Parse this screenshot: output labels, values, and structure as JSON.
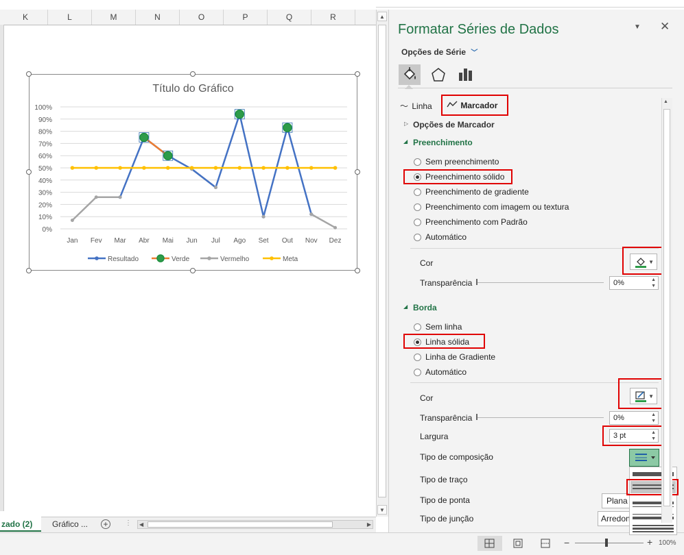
{
  "sheet": {
    "columns": [
      "K",
      "L",
      "M",
      "N",
      "O",
      "P",
      "Q",
      "R"
    ],
    "tabs": [
      {
        "label": "zado (2)",
        "active": true
      },
      {
        "label": "Gráfico   ...",
        "active": false
      }
    ]
  },
  "chart": {
    "title": "Título do Gráfico",
    "ytick_labels": [
      "100%",
      "90%",
      "80%",
      "70%",
      "60%",
      "50%",
      "40%",
      "30%",
      "20%",
      "10%",
      "0%"
    ],
    "legend": [
      "Resultado",
      "Verde",
      "Vermelho",
      "Meta"
    ]
  },
  "chart_data": {
    "type": "line",
    "title": "Título do Gráfico",
    "categories": [
      "Jan",
      "Fev",
      "Mar",
      "Abr",
      "Mai",
      "Jun",
      "Jul",
      "Ago",
      "Set",
      "Out",
      "Nov",
      "Dez"
    ],
    "ylim": [
      0,
      1
    ],
    "grid": true,
    "legend_position": "bottom",
    "series": [
      {
        "name": "Resultado",
        "color": "#4472c4",
        "values": [
          null,
          null,
          0.26,
          0.75,
          0.6,
          0.49,
          0.34,
          0.94,
          0.1,
          0.83,
          0.12,
          null
        ]
      },
      {
        "name": "Verde",
        "color": "#ed7d31",
        "marker_color": "#2e9c4a",
        "values": [
          null,
          null,
          null,
          0.75,
          0.6,
          null,
          null,
          0.94,
          null,
          0.83,
          null,
          null
        ]
      },
      {
        "name": "Vermelho",
        "color": "#a5a5a5",
        "values": [
          0.07,
          0.26,
          0.26,
          null,
          null,
          0.49,
          0.34,
          null,
          0.1,
          null,
          0.12,
          0.01
        ]
      },
      {
        "name": "Meta",
        "color": "#ffc000",
        "values": [
          0.5,
          0.5,
          0.5,
          0.5,
          0.5,
          0.5,
          0.5,
          0.5,
          0.5,
          0.5,
          0.5,
          0.5
        ]
      }
    ]
  },
  "pane": {
    "title": "Formatar Séries de Dados",
    "series_options": "Opções de Série",
    "tab_line": "Linha",
    "tab_marker": "Marcador",
    "marker_options": "Opções de Marcador",
    "fill_section": "Preenchimento",
    "fill_options": [
      "Sem preenchimento",
      "Preenchimento sólido",
      "Preenchimento de gradiente",
      "Preenchimento com imagem ou textura",
      "Preenchimento com Padrão",
      "Automático"
    ],
    "fill_selected": "Preenchimento sólido",
    "color_label": "Cor",
    "transparency_label": "Transparência",
    "fill_transparency": "0%",
    "border_section": "Borda",
    "border_options": [
      "Sem linha",
      "Linha sólida",
      "Linha de Gradiente",
      "Automático"
    ],
    "border_selected": "Linha sólida",
    "border_color_label": "Cor",
    "border_transparency_label": "Transparência",
    "border_transparency": "0%",
    "width_label": "Largura",
    "width_value": "3 pt",
    "compound_label": "Tipo de composição",
    "dash_label": "Tipo de traço",
    "cap_label": "Tipo de ponta",
    "cap_value": "Plana",
    "join_label": "Tipo de junção",
    "join_value": "Arredon",
    "accent_color": "#217346",
    "fill_color": "#2e9c4a"
  },
  "status": {
    "zoom": "100%"
  }
}
